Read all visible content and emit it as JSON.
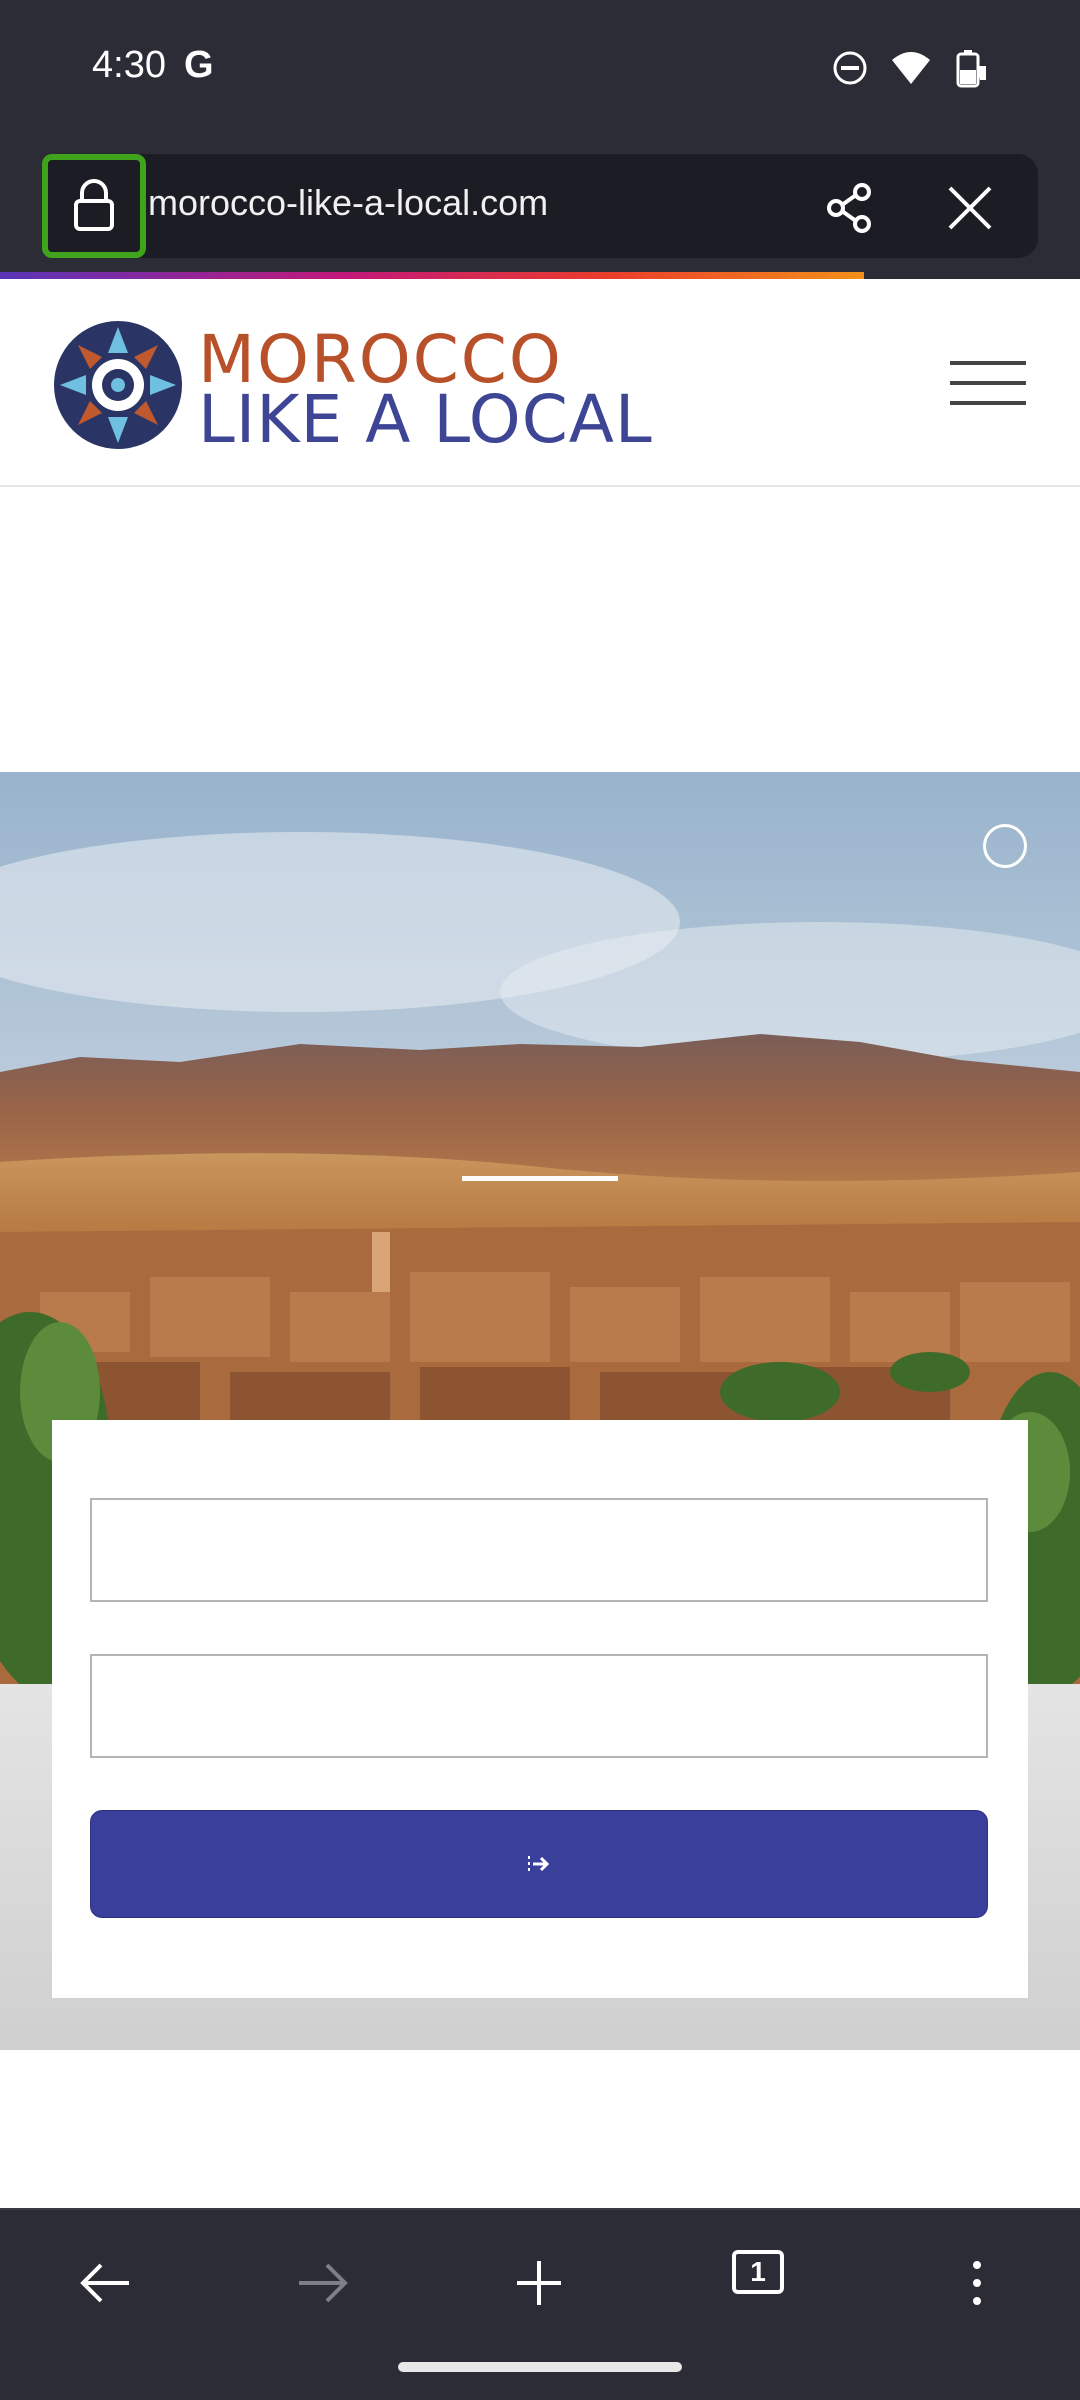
{
  "status_bar": {
    "time": "4:30",
    "google_glyph": "G",
    "icons": [
      "do-not-disturb-icon",
      "wifi-icon",
      "battery-icon"
    ]
  },
  "browser": {
    "url": "morocco-like-a-local.com",
    "lock_icon": "lock-icon",
    "share_icon": "share-icon",
    "close_icon": "close-icon",
    "page_load_progress": 0.8
  },
  "site": {
    "logo_line1": "MOROCCO",
    "logo_line2": "LIKE A LOCAL",
    "menu_icon": "hamburger-menu-icon",
    "colors": {
      "logo_orange": "#b8502a",
      "logo_blue": "#3d4594",
      "button_blue": "#3a3f9c"
    }
  },
  "form": {
    "field1_value": "",
    "field2_value": "",
    "submit_icon": "login-arrow-icon"
  },
  "toolbar": {
    "tab_count": "1",
    "back_icon": "back-arrow-icon",
    "forward_icon": "forward-arrow-icon",
    "new_tab_icon": "plus-icon",
    "more_icon": "more-vertical-icon"
  }
}
